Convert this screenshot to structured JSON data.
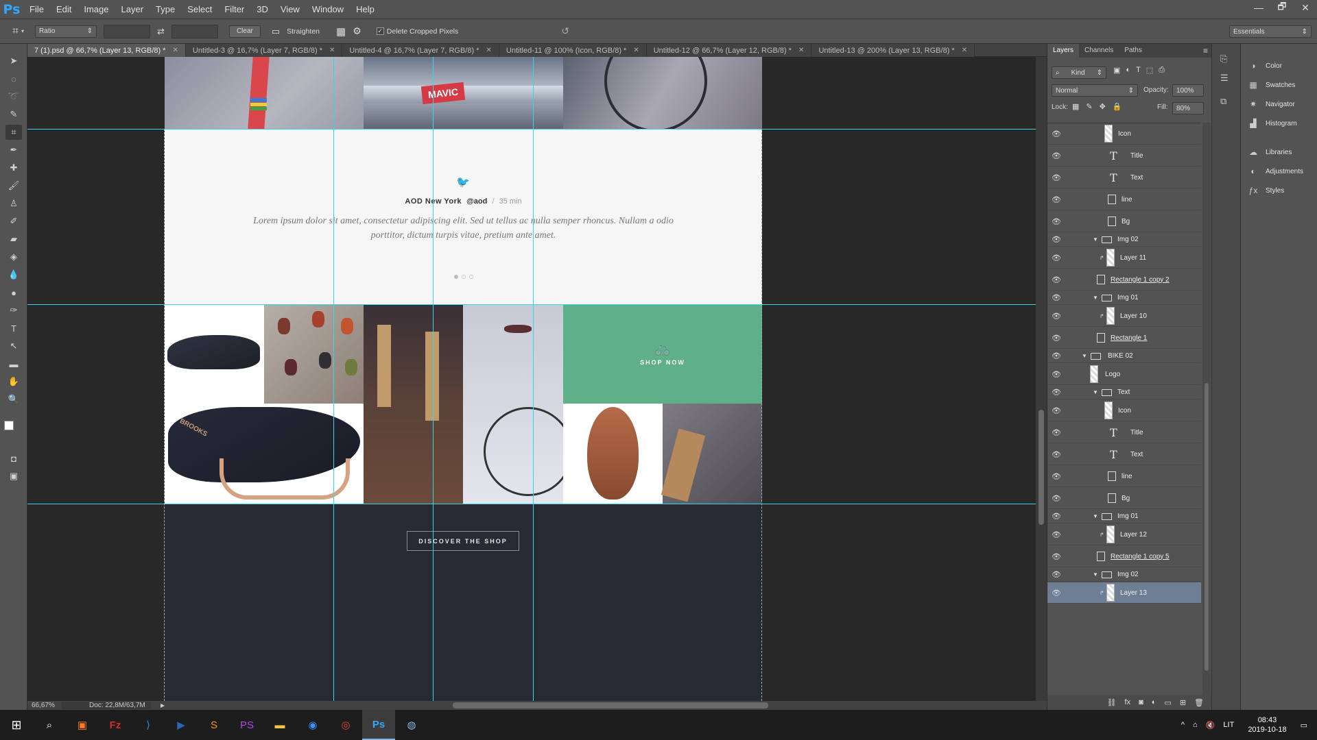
{
  "app": {
    "logo": "Ps"
  },
  "menu": [
    "File",
    "Edit",
    "Image",
    "Layer",
    "Type",
    "Select",
    "Filter",
    "3D",
    "View",
    "Window",
    "Help"
  ],
  "window_controls": [
    "—",
    "🗗",
    "✕"
  ],
  "options_bar": {
    "ratio_label": "Ratio",
    "clear_label": "Clear",
    "straighten_label": "Straighten",
    "delete_cropped_label": "Delete Cropped Pixels",
    "workspace": "Essentials"
  },
  "doc_tabs": [
    {
      "label": "7 (1).psd @ 66,7% (Layer 13, RGB/8) *"
    },
    {
      "label": "Untitled-3 @ 16,7% (Layer 7, RGB/8) *"
    },
    {
      "label": "Untitled-4 @ 16,7% (Layer 7, RGB/8) *"
    },
    {
      "label": "Untitled-11 @ 100% (Icon, RGB/8) *"
    },
    {
      "label": "Untitled-12 @ 66,7% (Layer 12, RGB/8) *"
    },
    {
      "label": "Untitled-13 @ 200% (Layer 13, RGB/8) *"
    }
  ],
  "canvas": {
    "tweet_author": "AOD New York",
    "tweet_handle": "@aod",
    "tweet_sep": "/",
    "tweet_time": "35 min",
    "tweet_text_1": "Lorem ipsum dolor sit amet, consectetur adipiscing elit. Sed ut tellus ac nulla semper rhoncus. Nullam a odio",
    "tweet_text_2": "porttitor, dictum turpis vitae, pretium ante amet.",
    "shop_now": "SHOP NOW",
    "discover": "DISCOVER THE SHOP",
    "mavic": "MAVIC",
    "brooks": "BROOKS"
  },
  "status": {
    "zoom": "66,67%",
    "doc": "Doc: 22,8M/63,7M"
  },
  "layers_panel": {
    "tabs": [
      "Layers",
      "Channels",
      "Paths"
    ],
    "kind": "Kind",
    "blend": "Normal",
    "opacity_label": "Opacity:",
    "opacity": "100%",
    "lock_label": "Lock:",
    "fill_label": "Fill:",
    "fill": "80%",
    "layers": [
      {
        "name": "Icon",
        "type": "smart"
      },
      {
        "name": "Title",
        "type": "text"
      },
      {
        "name": "Text",
        "type": "text"
      },
      {
        "name": "line",
        "type": "shape"
      },
      {
        "name": "Bg",
        "type": "shape"
      },
      {
        "name": "Img 02",
        "type": "group"
      },
      {
        "name": "Layer 11",
        "type": "clip"
      },
      {
        "name": "Rectangle 1 copy 2",
        "type": "shape"
      },
      {
        "name": "Img 01",
        "type": "group"
      },
      {
        "name": "Layer 10",
        "type": "clip"
      },
      {
        "name": "Rectangle 1",
        "type": "shape"
      },
      {
        "name": "BIKE 02",
        "type": "group"
      },
      {
        "name": "Logo",
        "type": "smart"
      },
      {
        "name": "Text",
        "type": "group"
      },
      {
        "name": "Icon",
        "type": "smart"
      },
      {
        "name": "Title",
        "type": "text"
      },
      {
        "name": "Text",
        "type": "text"
      },
      {
        "name": "line",
        "type": "shape"
      },
      {
        "name": "Bg",
        "type": "shape"
      },
      {
        "name": "Img 01",
        "type": "group"
      },
      {
        "name": "Layer 12",
        "type": "clip"
      },
      {
        "name": "Rectangle 1 copy 5",
        "type": "shape"
      },
      {
        "name": "Img 02",
        "type": "group"
      },
      {
        "name": "Layer 13",
        "type": "clip"
      }
    ]
  },
  "right_panel": [
    "Color",
    "Swatches",
    "Navigator",
    "Histogram",
    "Libraries",
    "Adjustments",
    "Styles"
  ],
  "taskbar": {
    "lang": "LIT",
    "time": "08:43",
    "date": "2019-10-18"
  }
}
